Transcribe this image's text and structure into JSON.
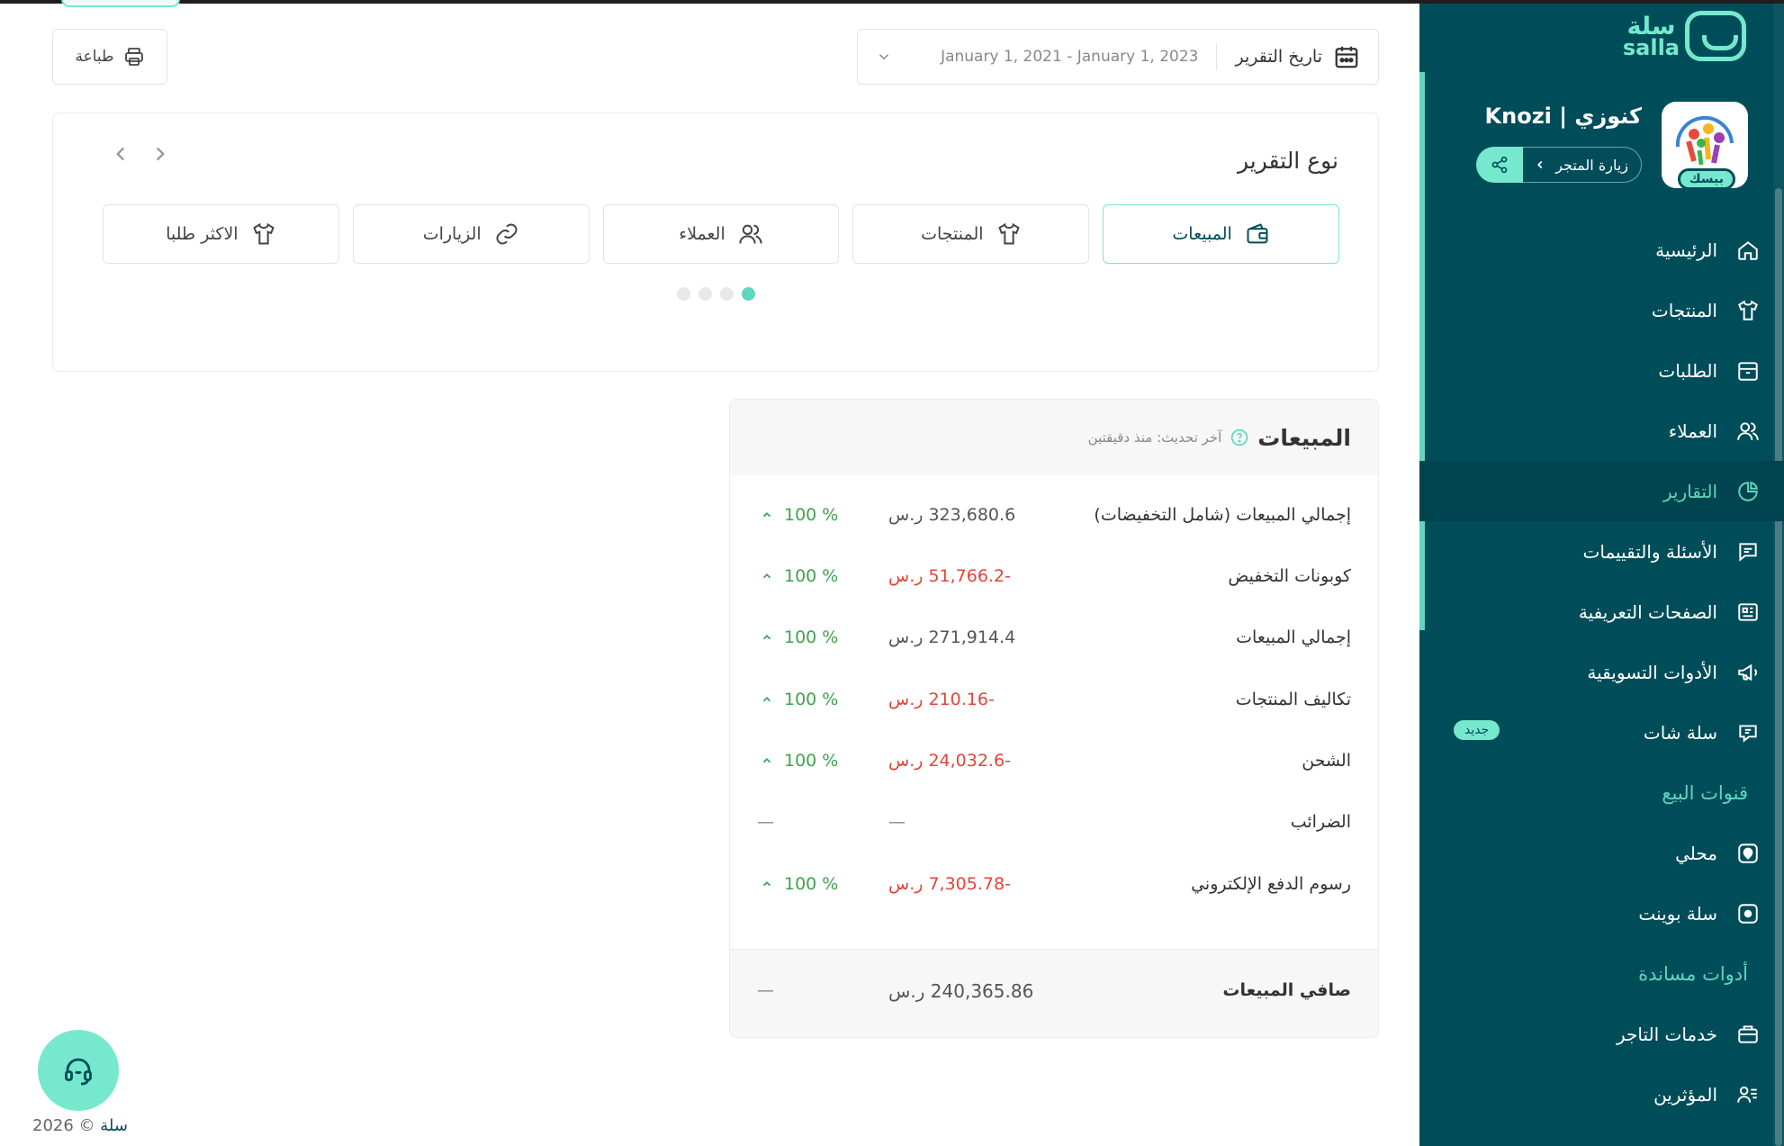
{
  "app": {
    "brand_ar": "سلة",
    "brand_en": "salla",
    "store_name": "كنوزي | Knozi",
    "store_badge": "بيسك",
    "visit_store": "زيارة المتجر",
    "copyright_brand": "سلة",
    "copyright_text": "© 2026"
  },
  "toolbar": {
    "print_label": "طباعة",
    "date_label": "تاريخ التقرير",
    "date_range": "January 1, 2021 - January 1, 2023"
  },
  "report_type": {
    "title": "نوع التقرير",
    "tabs": [
      {
        "label": "المبيعات",
        "icon": "wallet-icon",
        "active": true
      },
      {
        "label": "المنتجات",
        "icon": "shirt-icon",
        "active": false
      },
      {
        "label": "العملاء",
        "icon": "users-icon",
        "active": false
      },
      {
        "label": "الزيارات",
        "icon": "link-icon",
        "active": false
      },
      {
        "label": "الاكثر طلبا",
        "icon": "shirt-icon",
        "active": false
      }
    ],
    "active_page": 1,
    "page_count": 4
  },
  "sales": {
    "title": "المبيعات",
    "last_update": "آخر تحديث: منذ دقيقتين",
    "rows": [
      {
        "label": "إجمالي المبيعات (شامل التخفيضات)",
        "value": "323,680.6 ر.س",
        "negative": false,
        "pct": "100 %"
      },
      {
        "label": "كوبونات التخفيض",
        "value": "-51,766.2 ر.س",
        "negative": true,
        "pct": "100 %"
      },
      {
        "label": "إجمالي المبيعات",
        "value": "271,914.4 ر.س",
        "negative": false,
        "pct": "100 %"
      },
      {
        "label": "تكاليف المنتجات",
        "value": "-210.16 ر.س",
        "negative": true,
        "pct": "100 %"
      },
      {
        "label": "الشحن",
        "value": "-24,032.6 ر.س",
        "negative": true,
        "pct": "100 %"
      },
      {
        "label": "الضرائب",
        "value": "—",
        "negative": false,
        "pct": "—"
      },
      {
        "label": "رسوم الدفع الإلكتروني",
        "value": "-7,305.78 ر.س",
        "negative": true,
        "pct": "100 %"
      }
    ],
    "net_label": "صافي المبيعات",
    "net_value": "240,365.86 ر.س",
    "net_pct": "—"
  },
  "sidebar": {
    "items": [
      {
        "label": "الرئيسية",
        "icon": "home-icon"
      },
      {
        "label": "المنتجات",
        "icon": "shirt-icon"
      },
      {
        "label": "الطلبات",
        "icon": "box-icon"
      },
      {
        "label": "العملاء",
        "icon": "users-icon"
      },
      {
        "label": "التقارير",
        "icon": "pie-chart-icon",
        "active": true
      },
      {
        "label": "الأسئلة والتقييمات",
        "icon": "comment-icon"
      },
      {
        "label": "الصفحات التعريفية",
        "icon": "newspaper-icon"
      },
      {
        "label": "الأدوات التسويقية",
        "icon": "megaphone-icon"
      },
      {
        "label": "سلة شات",
        "icon": "chat-icon",
        "badge": "جديد"
      }
    ],
    "section_sales_channels": "قنوات البيع",
    "channels": [
      {
        "label": "محلي",
        "icon": "store-icon"
      },
      {
        "label": "سلة بوينت",
        "icon": "pos-icon"
      }
    ],
    "section_support_tools": "أدوات مساندة",
    "tools": [
      {
        "label": "خدمات التاجر",
        "icon": "briefcase-icon"
      },
      {
        "label": "المؤثرين",
        "icon": "influencer-icon"
      }
    ]
  },
  "colors": {
    "sidebar_bg": "#004d5a",
    "accent": "#76e8cd",
    "negative": "#e0453a",
    "positive": "#3fa34d"
  }
}
